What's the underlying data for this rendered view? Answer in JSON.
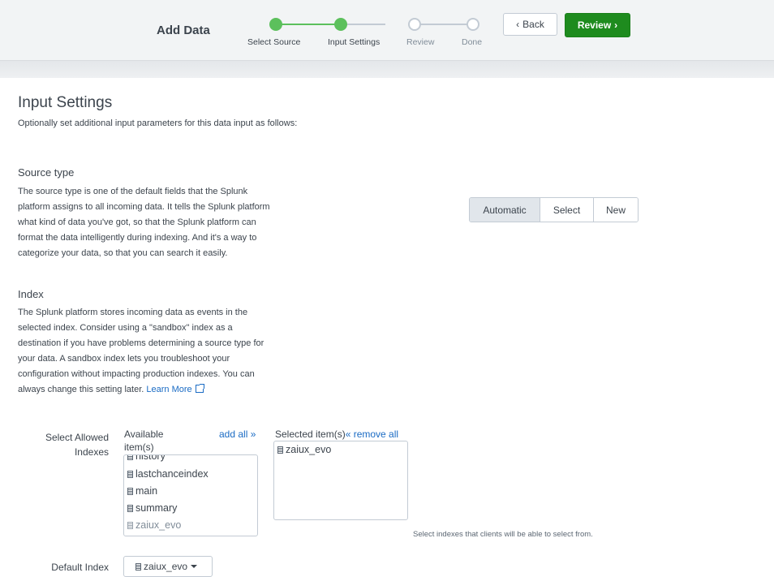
{
  "header": {
    "title": "Add Data",
    "steps": [
      {
        "label": "Select Source",
        "state": "done"
      },
      {
        "label": "Input Settings",
        "state": "done"
      },
      {
        "label": "Review",
        "state": "todo"
      },
      {
        "label": "Done",
        "state": "todo"
      }
    ],
    "back_label": "Back",
    "review_label": "Review",
    "colors": {
      "done": "#5cc05c",
      "primary": "#1e8b1e",
      "link": "#1a6bc4"
    }
  },
  "main": {
    "title": "Input Settings",
    "subtitle": "Optionally set additional input parameters for this data input as follows:"
  },
  "source_type": {
    "title": "Source type",
    "description": [
      "The source type is one of the default fields that the Splunk",
      "platform assigns to all incoming data. It tells the Splunk platform",
      "what kind of data you've got, so that the Splunk platform can",
      "format the data intelligently during indexing. And it's a way to",
      "categorize your data, so that you can search it easily."
    ],
    "options": [
      "Automatic",
      "Select",
      "New"
    ],
    "selected": "Automatic"
  },
  "index": {
    "title": "Index",
    "description": [
      "The Splunk platform stores incoming data as events in the",
      "selected index. Consider using a \"sandbox\" index as a",
      "destination if you have problems determining a source type for",
      "your data. A sandbox index lets you troubleshoot your",
      "configuration without impacting production indexes. You can",
      "always change this setting later."
    ],
    "learn_more": "Learn More",
    "allowed_label_1": "Select Allowed",
    "allowed_label_2": "Indexes",
    "available_head_1": "Available",
    "available_head_2": "item(s)",
    "add_all": "add all »",
    "selected_head": "Selected item(s)",
    "remove_all": "« remove all",
    "available_items": [
      {
        "name": "history",
        "muted": false
      },
      {
        "name": "lastchanceindex",
        "muted": false
      },
      {
        "name": "main",
        "muted": false
      },
      {
        "name": "summary",
        "muted": false
      },
      {
        "name": "zaiux_evo",
        "muted": true
      }
    ],
    "selected_items": [
      "zaiux_evo"
    ],
    "help_text": "Select indexes that clients will be able to select from.",
    "default_label": "Default Index",
    "default_value": "zaiux_evo"
  }
}
